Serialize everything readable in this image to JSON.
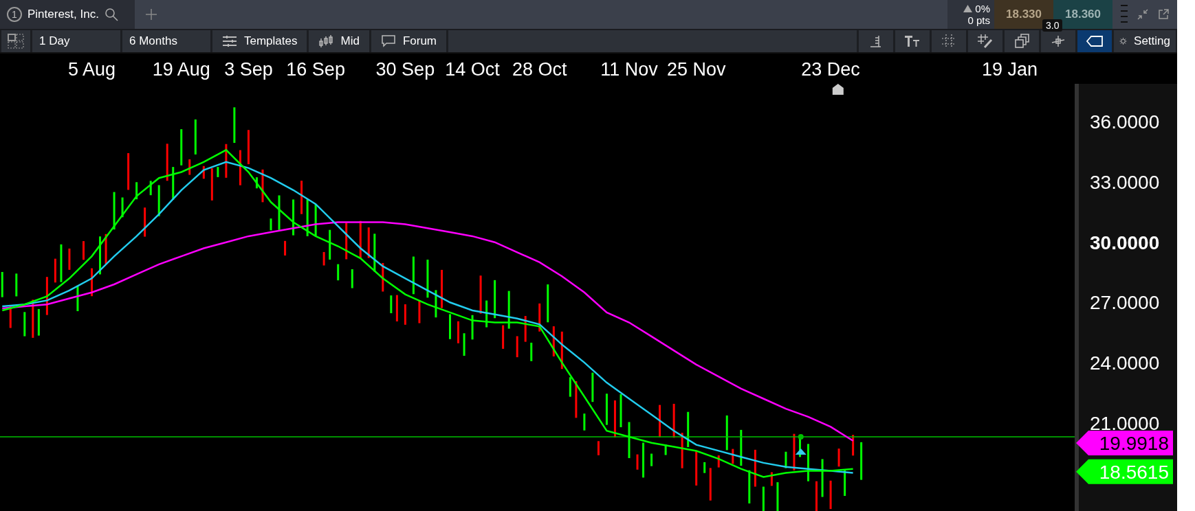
{
  "tab": {
    "number": "1",
    "title": "Pinterest, Inc."
  },
  "quote": {
    "change": "0%",
    "points": "0 pts",
    "bid": "18.330",
    "ask": "18.360",
    "spread": "3.0"
  },
  "toolbar": {
    "interval": "1 Day",
    "range": "6 Months",
    "buttons": [
      {
        "label": "Templates",
        "kind": "templates"
      },
      {
        "label": "Mid",
        "kind": "mid"
      },
      {
        "label": "Forum",
        "kind": "forum"
      }
    ],
    "tools": [
      {
        "kind": "list",
        "selected": false
      },
      {
        "kind": "text-size",
        "selected": false
      },
      {
        "kind": "grid",
        "selected": false
      },
      {
        "kind": "grid-pen",
        "selected": false
      },
      {
        "kind": "windows",
        "selected": false
      },
      {
        "kind": "crosshair",
        "selected": false
      },
      {
        "kind": "tag",
        "selected": true
      }
    ],
    "settings": "Setting"
  },
  "chart": {
    "chart_data": {
      "type": "line",
      "ylim": [
        16.6,
        37.9
      ],
      "categories": [
        null,
        null,
        null,
        null,
        "5 Aug",
        null,
        null,
        null,
        "19 Aug",
        null,
        null,
        "3 Sep",
        null,
        null,
        "16 Sep",
        null,
        null,
        null,
        "30 Sep",
        null,
        null,
        "14 Oct",
        null,
        null,
        "28 Oct",
        null,
        null,
        null,
        "11 Nov",
        null,
        null,
        "25 Nov",
        null,
        null,
        null,
        null,
        null,
        "23 Dec",
        null,
        null,
        null,
        null,
        null,
        null,
        null,
        "19 Jan",
        null,
        null
      ],
      "yticks": [
        {
          "value": 36,
          "label": "36.0000"
        },
        {
          "value": 33,
          "label": "33.0000"
        },
        {
          "value": 30,
          "label": "30.0000"
        },
        {
          "value": 27,
          "label": "27.0000"
        },
        {
          "value": 24,
          "label": "24.0000"
        },
        {
          "value": 21,
          "label": "21.0000"
        }
      ],
      "series": [
        {
          "color": "#ff00ff",
          "values": [
            26.7,
            26.8,
            26.9,
            27.2,
            27.5,
            27.9,
            28.4,
            28.9,
            29.3,
            29.7,
            30.0,
            30.3,
            30.5,
            30.7,
            30.9,
            31.0,
            31.0,
            31.0,
            30.9,
            30.7,
            30.5,
            30.3,
            30.0,
            29.5,
            29.0,
            28.3,
            27.5,
            26.5,
            26.0,
            25.3,
            24.6,
            23.9,
            23.3,
            22.7,
            22.2,
            21.7,
            21.3,
            20.8,
            20.1,
            null,
            null,
            null,
            null,
            null,
            null,
            null,
            null,
            null
          ]
        },
        {
          "color": "#22ccee",
          "values": [
            26.8,
            26.9,
            27.1,
            27.6,
            28.2,
            29.3,
            30.3,
            31.4,
            32.6,
            33.6,
            34.0,
            33.7,
            33.2,
            32.6,
            31.9,
            30.8,
            29.7,
            28.8,
            28.2,
            27.6,
            27.0,
            26.6,
            26.4,
            26.2,
            25.9,
            24.9,
            24.0,
            23.0,
            22.2,
            21.4,
            20.6,
            19.9,
            19.6,
            19.3,
            19.0,
            18.8,
            18.7,
            18.6,
            18.5,
            null,
            null,
            null,
            null,
            null,
            null,
            null,
            null,
            null
          ]
        },
        {
          "color": "#00ff00",
          "values": [
            26.6,
            26.9,
            27.3,
            28.2,
            29.3,
            30.8,
            32.3,
            33.2,
            33.5,
            34.0,
            34.6,
            33.5,
            32.0,
            31.0,
            30.3,
            29.8,
            29.2,
            28.2,
            27.4,
            26.9,
            26.5,
            26.1,
            26.0,
            26.0,
            25.8,
            24.0,
            22.3,
            20.6,
            20.3,
            20.0,
            19.8,
            19.6,
            19.2,
            18.7,
            18.3,
            18.5,
            18.6,
            18.6,
            18.7,
            null,
            null,
            null,
            null,
            null,
            null,
            null,
            null,
            null
          ]
        }
      ],
      "ref_lines": [
        {
          "axis": "y",
          "value": 20.3,
          "color": "#00c000"
        }
      ]
    },
    "ytick_highlight": [
      false,
      false,
      true,
      false,
      false,
      false
    ],
    "markers": [
      {
        "kind": "dot",
        "color": "#00c000"
      },
      {
        "kind": "up-marker",
        "color": "#33ccee"
      },
      {
        "kind": "top-marker",
        "color": "#cccccc"
      }
    ],
    "price_tags": [
      {
        "value": "19.9918",
        "color": "#ff00ff",
        "dark_text": true
      },
      {
        "value": "18.5615",
        "color": "#00ff00",
        "dark_text": false
      }
    ]
  }
}
